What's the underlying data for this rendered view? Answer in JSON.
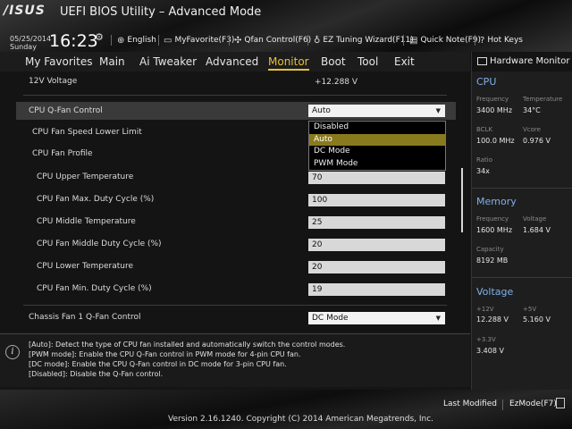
{
  "header": {
    "logo": "/ISUS",
    "title": "UEFI BIOS Utility – Advanced Mode",
    "date": "05/25/2014",
    "day": "Sunday",
    "time": "16:23",
    "buttons": [
      {
        "label": "English",
        "icon": "globe-icon"
      },
      {
        "label": "MyFavorite(F3)",
        "icon": "favorite-icon"
      },
      {
        "label": "Qfan Control(F6)",
        "icon": "fan-icon"
      },
      {
        "label": "EZ Tuning Wizard(F11)",
        "icon": "bulb-icon"
      },
      {
        "label": "Quick Note(F9)",
        "icon": "note-icon"
      },
      {
        "label": "Hot Keys",
        "icon": "help-icon"
      }
    ]
  },
  "menu": {
    "items": [
      "My Favorites",
      "Main",
      "Ai Tweaker",
      "Advanced",
      "Monitor",
      "Boot",
      "Tool",
      "Exit"
    ],
    "active": "Monitor"
  },
  "settings": {
    "voltage_12v": {
      "label": "12V Voltage",
      "value": "+12.288 V"
    },
    "cpu_qfan": {
      "label": "CPU Q-Fan Control",
      "value": "Auto"
    },
    "speed_lower": {
      "label": "CPU Fan Speed Lower Limit"
    },
    "profile": {
      "label": "CPU Fan Profile"
    },
    "upper_temp": {
      "label": "CPU Upper Temperature",
      "value": "70"
    },
    "max_duty": {
      "label": "CPU Fan Max. Duty Cycle (%)",
      "value": "100"
    },
    "middle_temp": {
      "label": "CPU Middle Temperature",
      "value": "25"
    },
    "middle_duty": {
      "label": "CPU Fan Middle Duty Cycle (%)",
      "value": "20"
    },
    "lower_temp": {
      "label": "CPU Lower Temperature",
      "value": "20"
    },
    "min_duty": {
      "label": "CPU Fan Min. Duty Cycle (%)",
      "value": "19"
    },
    "chassis_qfan": {
      "label": "Chassis Fan 1 Q-Fan Control",
      "value": "DC Mode"
    }
  },
  "dropdown": {
    "options": [
      "Disabled",
      "Auto",
      "DC Mode",
      "PWM Mode"
    ],
    "selected": "Auto"
  },
  "help": [
    "[Auto]: Detect the type of CPU fan installed and automatically switch the control modes.",
    "[PWM mode]: Enable the CPU Q-Fan control in PWM mode for 4-pin CPU fan.",
    "[DC mode]: Enable the CPU Q-Fan control in DC mode for 3-pin CPU fan.",
    "[Disabled]: Disable the Q-Fan control."
  ],
  "hwmon": {
    "title": "Hardware Monitor",
    "cpu": {
      "title": "CPU",
      "frequency_label": "Frequency",
      "frequency": "3400 MHz",
      "temperature_label": "Temperature",
      "temperature": "34°C",
      "bclk_label": "BCLK",
      "bclk": "100.0 MHz",
      "vcore_label": "Vcore",
      "vcore": "0.976 V",
      "ratio_label": "Ratio",
      "ratio": "34x"
    },
    "memory": {
      "title": "Memory",
      "frequency_label": "Frequency",
      "frequency": "1600 MHz",
      "voltage_label": "Voltage",
      "voltage": "1.684 V",
      "capacity_label": "Capacity",
      "capacity": "8192 MB"
    },
    "voltage": {
      "title": "Voltage",
      "v12_label": "+12V",
      "v12": "12.288 V",
      "v5_label": "+5V",
      "v5": "5.160 V",
      "v33_label": "+3.3V",
      "v33": "3.408 V"
    }
  },
  "footer": {
    "last_modified": "Last Modified",
    "ez_mode": "EzMode(F7)",
    "version": "Version 2.16.1240. Copyright (C) 2014 American Megatrends, Inc."
  }
}
